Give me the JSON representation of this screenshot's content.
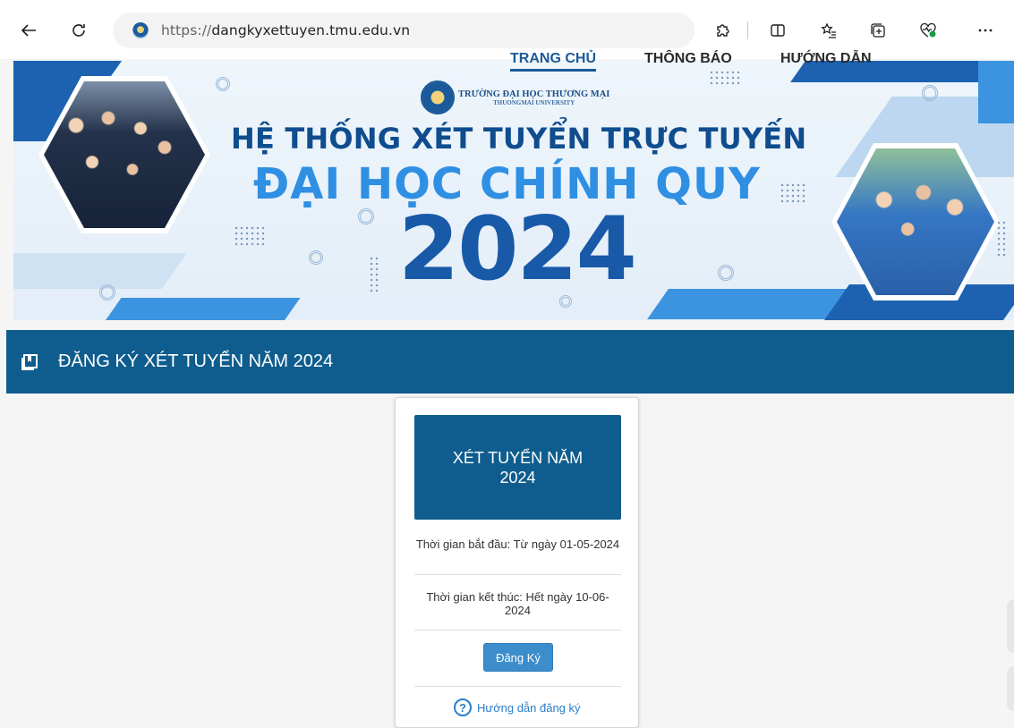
{
  "browser": {
    "url_protocol": "https://",
    "url_host": "dangkyxettuyen.tmu.edu.vn"
  },
  "nav": {
    "items": [
      "TRANG CHỦ",
      "THÔNG BÁO",
      "HƯỚNG DẪN"
    ]
  },
  "banner": {
    "logo_line1": "TRƯỜNG ĐẠI HỌC THƯƠNG MẠI",
    "logo_line2": "THUONGMAI UNIVERSITY",
    "headline": "HỆ THỐNG XÉT TUYỂN TRỰC TUYẾN",
    "subheadline": "ĐẠI HỌC CHÍNH QUY",
    "year": "2024"
  },
  "section": {
    "title": "ĐĂNG KÝ XÉT TUYỂN NĂM 2024"
  },
  "card": {
    "title": "XÉT TUYỂN NĂM 2024",
    "start": "Thời gian bắt đầu: Từ ngày 01-05-2024",
    "end": "Thời gian kết thúc: Hết ngày 10-06-2024",
    "button": "Đăng Ký",
    "help": "Hướng dẫn đăng ký",
    "help_icon": "?"
  },
  "colors": {
    "primary": "#0f5d8e",
    "button": "#3c8dcb",
    "link": "#2a7ec9"
  }
}
